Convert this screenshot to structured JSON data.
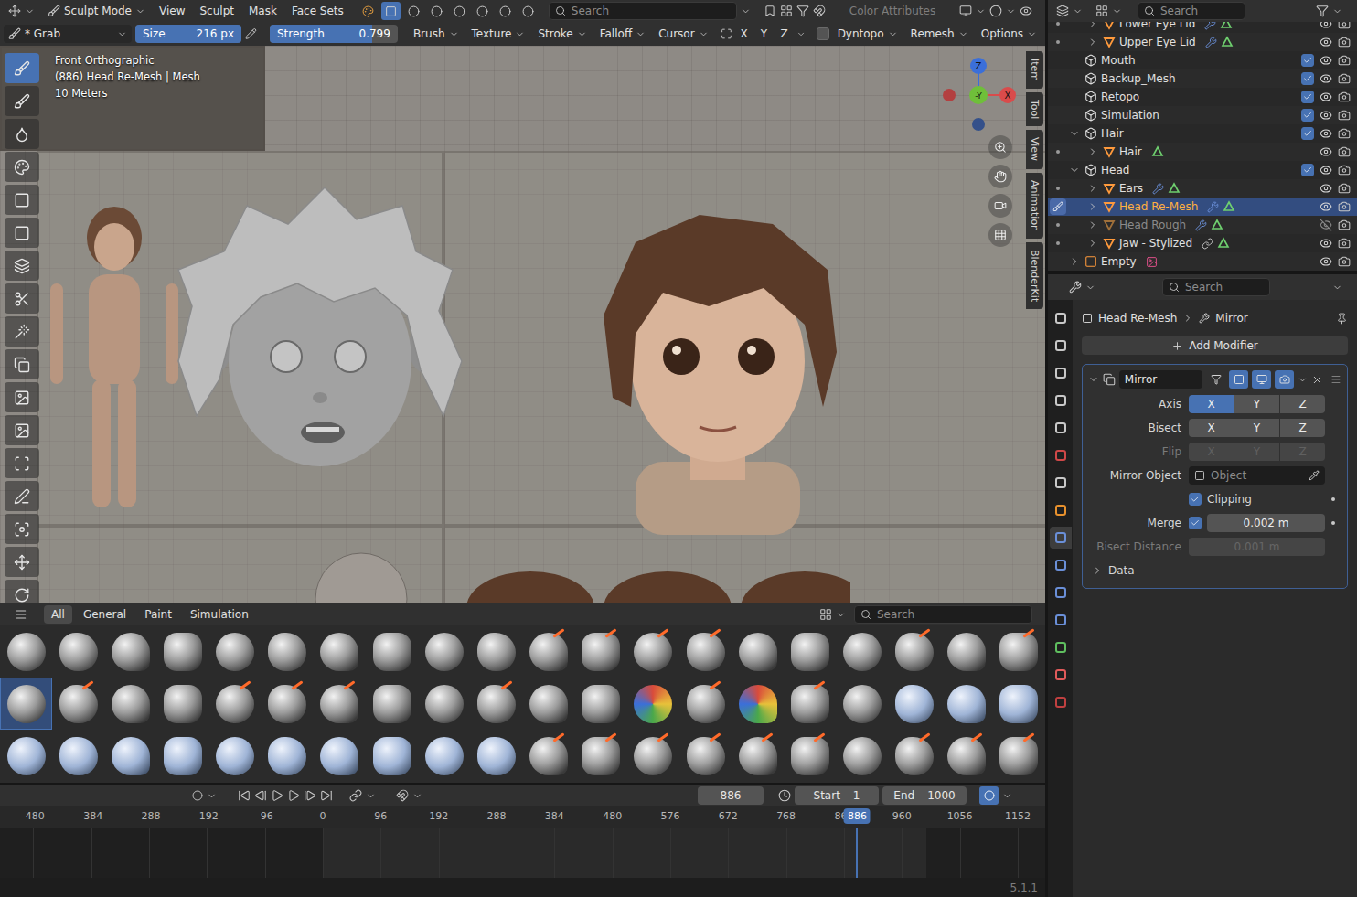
{
  "header": {
    "mode": "Sculpt Mode",
    "menus": [
      "View",
      "Sculpt",
      "Mask",
      "Face Sets"
    ],
    "display_toggles": [
      {
        "selected": false
      },
      {
        "selected": true
      },
      {
        "selected": false
      },
      {
        "selected": false
      },
      {
        "selected": false
      },
      {
        "selected": false
      },
      {
        "selected": false
      },
      {
        "selected": false
      }
    ],
    "search": {
      "placeholder": "Search"
    },
    "color_attributes": "Color Attributes"
  },
  "tool_settings": {
    "brush": "* Grab",
    "size": {
      "label": "Size",
      "value": "216 px",
      "level": 1.0
    },
    "strength": {
      "label": "Strength",
      "value": "0.799",
      "level": 0.799
    },
    "menus": [
      "Brush",
      "Texture",
      "Stroke",
      "Falloff",
      "Cursor"
    ],
    "symmetry": [
      {
        "label": "X",
        "on": false
      },
      {
        "label": "Y",
        "on": false
      },
      {
        "label": "Z",
        "on": false
      }
    ],
    "dyntopo": {
      "label": "Dyntopo",
      "checked": false
    },
    "extra_menus": [
      "Remesh",
      "Options"
    ]
  },
  "viewport": {
    "view_name": "Front Orthographic",
    "object_info": "(886) Head Re-Mesh | Mesh",
    "scale": "10 Meters",
    "gizmo": {
      "z": "Z",
      "y": "-Y",
      "x": "X"
    },
    "side_tabs": [
      "Item",
      "Tool",
      "View",
      "Animation",
      "BlenderKit"
    ],
    "tools": [
      {
        "selected": true
      },
      {
        "selected": false
      },
      {
        "selected": false
      },
      {
        "selected": false
      },
      {
        "selected": false
      },
      {
        "selected": false
      },
      {
        "selected": false
      },
      {
        "selected": false
      },
      {
        "selected": false
      },
      {
        "selected": false
      },
      {
        "selected": false
      },
      {
        "selected": false
      },
      {
        "selected": false
      },
      {
        "selected": false
      },
      {
        "selected": false
      },
      {
        "selected": false
      },
      {
        "selected": false
      }
    ]
  },
  "asset_shelf": {
    "tabs": [
      {
        "label": "All",
        "selected": true
      },
      {
        "label": "General",
        "selected": false
      },
      {
        "label": "Paint",
        "selected": false
      },
      {
        "label": "Simulation",
        "selected": false
      }
    ],
    "search": {
      "placeholder": "Search"
    },
    "assets": [
      {
        "kind": "gray",
        "selected": false
      },
      {
        "kind": "gray",
        "selected": false
      },
      {
        "kind": "gray",
        "selected": false
      },
      {
        "kind": "gray",
        "selected": false
      },
      {
        "kind": "gray",
        "selected": false
      },
      {
        "kind": "gray",
        "selected": false
      },
      {
        "kind": "gray",
        "selected": false
      },
      {
        "kind": "gray",
        "selected": false
      },
      {
        "kind": "gray",
        "selected": false
      },
      {
        "kind": "gray",
        "selected": false
      },
      {
        "kind": "accent",
        "selected": false
      },
      {
        "kind": "accent",
        "selected": false
      },
      {
        "kind": "accent",
        "selected": false
      },
      {
        "kind": "accent",
        "selected": false
      },
      {
        "kind": "gray",
        "selected": false
      },
      {
        "kind": "gray",
        "selected": false
      },
      {
        "kind": "gray",
        "selected": false
      },
      {
        "kind": "accent",
        "selected": false
      },
      {
        "kind": "gray",
        "selected": false
      },
      {
        "kind": "accent",
        "selected": false
      },
      {
        "kind": "gray",
        "selected": true
      },
      {
        "kind": "accent",
        "selected": false
      },
      {
        "kind": "gray",
        "selected": false
      },
      {
        "kind": "gray",
        "selected": false
      },
      {
        "kind": "accent",
        "selected": false
      },
      {
        "kind": "accent",
        "selected": false
      },
      {
        "kind": "accent",
        "selected": false
      },
      {
        "kind": "gray",
        "selected": false
      },
      {
        "kind": "gray",
        "selected": false
      },
      {
        "kind": "accent",
        "selected": false
      },
      {
        "kind": "gray",
        "selected": false
      },
      {
        "kind": "gray",
        "selected": false
      },
      {
        "kind": "color",
        "selected": false
      },
      {
        "kind": "accent",
        "selected": false
      },
      {
        "kind": "color",
        "selected": false
      },
      {
        "kind": "accent",
        "selected": false
      },
      {
        "kind": "gray",
        "selected": false
      },
      {
        "kind": "blue",
        "selected": false
      },
      {
        "kind": "blue",
        "selected": false
      },
      {
        "kind": "blue",
        "selected": false
      },
      {
        "kind": "blue",
        "selected": false
      },
      {
        "kind": "blue",
        "selected": false
      },
      {
        "kind": "blue",
        "selected": false
      },
      {
        "kind": "blue",
        "selected": false
      },
      {
        "kind": "blue",
        "selected": false
      },
      {
        "kind": "blue",
        "selected": false
      },
      {
        "kind": "blue",
        "selected": false
      },
      {
        "kind": "blue",
        "selected": false
      },
      {
        "kind": "blue",
        "selected": false
      },
      {
        "kind": "blue",
        "selected": false
      },
      {
        "kind": "accent",
        "selected": false
      },
      {
        "kind": "accent",
        "selected": false
      },
      {
        "kind": "accent",
        "selected": false
      },
      {
        "kind": "accent",
        "selected": false
      },
      {
        "kind": "accent",
        "selected": false
      },
      {
        "kind": "accent",
        "selected": false
      },
      {
        "kind": "gray",
        "selected": false
      },
      {
        "kind": "accent",
        "selected": false
      },
      {
        "kind": "accent",
        "selected": false
      },
      {
        "kind": "accent",
        "selected": false
      }
    ]
  },
  "timeline": {
    "current_frame": "886",
    "start_label": "Start",
    "start": "1",
    "end_label": "End",
    "end": "1000",
    "ticks": [
      "-480",
      "-384",
      "-288",
      "-192",
      "-96",
      "0",
      "96",
      "192",
      "288",
      "384",
      "480",
      "576",
      "672",
      "768",
      "864",
      "960",
      "1056",
      "1152"
    ],
    "playhead": "886"
  },
  "status_bar": {
    "version": "5.1.1"
  },
  "outliner": {
    "search": {
      "placeholder": "Search"
    },
    "rows": [
      {
        "name": "Lower Eye Lid",
        "kind": "mesh",
        "depth": 2,
        "expandable": true,
        "expanded": false,
        "selected": false,
        "hidden": false,
        "editing": false,
        "dot": true,
        "modifiers": true,
        "data": true,
        "constraint": false,
        "image": false
      },
      {
        "name": "Upper Eye Lid",
        "kind": "mesh",
        "depth": 2,
        "expandable": true,
        "expanded": false,
        "selected": false,
        "hidden": false,
        "editing": false,
        "dot": true,
        "modifiers": true,
        "data": true,
        "constraint": false,
        "image": false
      },
      {
        "name": "Mouth",
        "kind": "collection",
        "depth": 1,
        "expandable": false,
        "expanded": false,
        "selected": false,
        "hidden": false,
        "editing": false,
        "dot": false,
        "modifiers": false,
        "data": false,
        "constraint": false,
        "image": false,
        "checked": true
      },
      {
        "name": "Backup_Mesh",
        "kind": "collection",
        "depth": 1,
        "expandable": false,
        "expanded": false,
        "selected": false,
        "hidden": false,
        "editing": false,
        "dot": false,
        "modifiers": false,
        "data": false,
        "constraint": false,
        "image": false,
        "checked": true
      },
      {
        "name": "Retopo",
        "kind": "collection",
        "depth": 1,
        "expandable": false,
        "expanded": false,
        "selected": false,
        "hidden": false,
        "editing": false,
        "dot": false,
        "modifiers": false,
        "data": false,
        "constraint": false,
        "image": false,
        "checked": true
      },
      {
        "name": "Simulation",
        "kind": "collection",
        "depth": 1,
        "expandable": false,
        "expanded": false,
        "selected": false,
        "hidden": false,
        "editing": false,
        "dot": false,
        "modifiers": false,
        "data": false,
        "constraint": false,
        "image": false,
        "checked": true
      },
      {
        "name": "Hair",
        "kind": "collection",
        "depth": 1,
        "expandable": true,
        "expanded": true,
        "selected": false,
        "hidden": false,
        "editing": false,
        "dot": false,
        "modifiers": false,
        "data": false,
        "constraint": false,
        "image": false,
        "checked": true
      },
      {
        "name": "Hair",
        "kind": "mesh",
        "depth": 2,
        "expandable": true,
        "expanded": false,
        "selected": false,
        "hidden": false,
        "editing": false,
        "dot": true,
        "modifiers": false,
        "data": true,
        "constraint": false,
        "image": false
      },
      {
        "name": "Head",
        "kind": "collection",
        "depth": 1,
        "expandable": true,
        "expanded": true,
        "selected": false,
        "hidden": false,
        "editing": false,
        "dot": false,
        "modifiers": false,
        "data": false,
        "constraint": false,
        "image": false,
        "checked": true
      },
      {
        "name": "Ears",
        "kind": "mesh",
        "depth": 2,
        "expandable": true,
        "expanded": false,
        "selected": false,
        "hidden": false,
        "editing": false,
        "dot": true,
        "modifiers": true,
        "data": true,
        "constraint": false,
        "image": false
      },
      {
        "name": "Head Re-Mesh",
        "kind": "mesh",
        "depth": 2,
        "expandable": true,
        "expanded": false,
        "selected": true,
        "hidden": false,
        "editing": true,
        "dot": false,
        "modifiers": true,
        "data": true,
        "constraint": false,
        "image": false
      },
      {
        "name": "Head Rough",
        "kind": "mesh",
        "depth": 2,
        "expandable": true,
        "expanded": false,
        "selected": false,
        "hidden": true,
        "editing": false,
        "dot": true,
        "modifiers": true,
        "data": true,
        "constraint": false,
        "image": false
      },
      {
        "name": "Jaw - Stylized",
        "kind": "mesh",
        "depth": 2,
        "expandable": true,
        "expanded": false,
        "selected": false,
        "hidden": false,
        "editing": false,
        "dot": true,
        "modifiers": false,
        "data": true,
        "constraint": true,
        "image": false
      },
      {
        "name": "Empty",
        "kind": "empty",
        "depth": 1,
        "expandable": true,
        "expanded": false,
        "selected": false,
        "hidden": false,
        "editing": false,
        "dot": false,
        "modifiers": false,
        "data": false,
        "constraint": false,
        "image": true
      }
    ]
  },
  "properties": {
    "search": {
      "placeholder": "Search"
    },
    "tabs": [
      {
        "color": "#c8c8c8",
        "selected": false
      },
      {
        "color": "#c8c8c8",
        "selected": false
      },
      {
        "color": "#c8c8c8",
        "selected": false
      },
      {
        "color": "#c8c8c8",
        "selected": false
      },
      {
        "color": "#c8c8c8",
        "selected": false
      },
      {
        "color": "#d04848",
        "selected": false
      },
      {
        "color": "#c8c8c8",
        "selected": false
      },
      {
        "color": "#e8912d",
        "selected": false
      },
      {
        "color": "#6a8fd8",
        "selected": true
      },
      {
        "color": "#6a8fd8",
        "selected": false
      },
      {
        "color": "#6a8fd8",
        "selected": false
      },
      {
        "color": "#6a8fd8",
        "selected": false
      },
      {
        "color": "#5fbf5f",
        "selected": false
      },
      {
        "color": "#e05a5a",
        "selected": false
      },
      {
        "color": "#c04040",
        "selected": false
      }
    ],
    "breadcrumb": [
      "Head Re-Mesh",
      "Mirror"
    ],
    "add_modifier": "Add Modifier",
    "modifier": {
      "name": "Mirror",
      "expanded": true,
      "toggles": [
        {
          "on": false
        },
        {
          "on": true
        },
        {
          "on": true
        },
        {
          "on": true
        }
      ],
      "rows": [
        {
          "kind": "toggles",
          "label": "Axis",
          "disabled": false,
          "decorator": false,
          "options": [
            {
              "label": "X",
              "on": true
            },
            {
              "label": "Y",
              "on": false
            },
            {
              "label": "Z",
              "on": false
            }
          ]
        },
        {
          "kind": "toggles",
          "label": "Bisect",
          "disabled": false,
          "decorator": false,
          "options": [
            {
              "label": "X",
              "on": false
            },
            {
              "label": "Y",
              "on": false
            },
            {
              "label": "Z",
              "on": false
            }
          ]
        },
        {
          "kind": "toggles",
          "label": "Flip",
          "disabled": true,
          "decorator": false,
          "options": [
            {
              "label": "X",
              "on": false
            },
            {
              "label": "Y",
              "on": false
            },
            {
              "label": "Z",
              "on": false
            }
          ]
        },
        {
          "kind": "object",
          "label": "Mirror Object",
          "placeholder": "Object",
          "disabled": false,
          "decorator": false
        },
        {
          "kind": "check",
          "label": "Clipping",
          "checked": true,
          "disabled": false,
          "decorator": true
        },
        {
          "kind": "check_number",
          "label": "Merge",
          "checked": true,
          "value": "0.002 m",
          "disabled": false,
          "decorator": true
        },
        {
          "kind": "number",
          "label": "Bisect Distance",
          "value": "0.001 m",
          "disabled": true,
          "decorator": false
        }
      ],
      "data_section": {
        "label": "Data",
        "expanded": false
      }
    }
  }
}
